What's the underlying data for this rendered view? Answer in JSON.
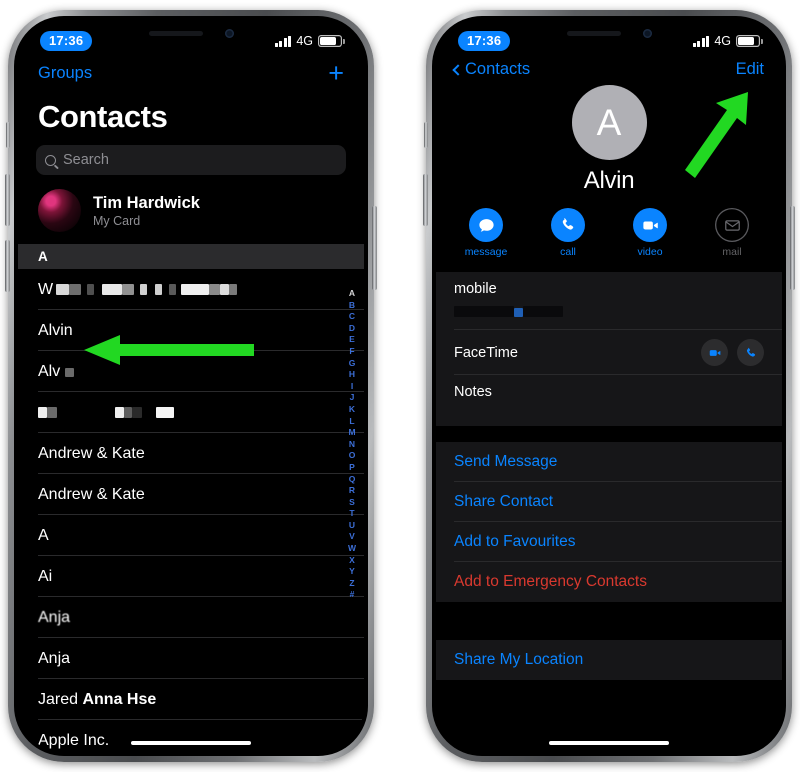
{
  "status_bar": {
    "time": "17:36",
    "network": "4G",
    "signal_icon": "cellular-bars-icon",
    "battery_icon": "battery-icon",
    "time_pill_color": "#0a84ff"
  },
  "colors": {
    "ios_blue": "#0a84ff",
    "ios_red": "#d9392f",
    "arrow_green": "#22d822",
    "screen_bg": "#000000",
    "card_bg": "#161618",
    "section_header_bg": "#2b2b2d"
  },
  "left_phone": {
    "nav": {
      "groups_label": "Groups",
      "add_label": "+"
    },
    "title": "Contacts",
    "search": {
      "placeholder": "Search",
      "value": "",
      "icon": "search-icon"
    },
    "my_card": {
      "name": "Tim Hardwick",
      "subtitle": "My Card",
      "avatar": "photo-avatar"
    },
    "section_header": "A",
    "rows": [
      {
        "prefix": "W",
        "redacted": true,
        "blocks": [
          14,
          9,
          6,
          5,
          5,
          22,
          9,
          5,
          4,
          5,
          4,
          4,
          26,
          12,
          9,
          5
        ],
        "label": ""
      },
      {
        "label": "Alvin",
        "redacted": false
      },
      {
        "prefix": "Alv",
        "redacted": true,
        "blocks": [
          7
        ],
        "label": ""
      },
      {
        "prefix": "",
        "redacted": true,
        "blocks": [
          9,
          9,
          0,
          0,
          0,
          8,
          9,
          10,
          0,
          16
        ],
        "label": ""
      },
      {
        "label": "Andrew & Kate",
        "redacted": false
      },
      {
        "label": "Andrew & Kate",
        "redacted": false
      },
      {
        "label": "A",
        "redacted": false
      },
      {
        "label": "Ai",
        "redacted": false
      },
      {
        "label": "Anja",
        "redacted": false,
        "smudged": true
      },
      {
        "label": "Anja",
        "redacted": false
      },
      {
        "label": "Jared Anna Hse",
        "redacted": false,
        "bold_part": "Anna Hse"
      },
      {
        "label": "Apple Inc.",
        "redacted": false
      }
    ],
    "index_letters": [
      "A",
      "B",
      "C",
      "D",
      "E",
      "F",
      "G",
      "H",
      "I",
      "J",
      "K",
      "L",
      "M",
      "N",
      "O",
      "P",
      "Q",
      "R",
      "S",
      "T",
      "U",
      "V",
      "W",
      "X",
      "Y",
      "Z",
      "#"
    ],
    "index_current": "A"
  },
  "right_phone": {
    "nav": {
      "back_label": "Contacts",
      "back_icon": "chevron-left-icon",
      "edit_label": "Edit"
    },
    "contact": {
      "monogram": "A",
      "name": "Alvin"
    },
    "actions": [
      {
        "label": "message",
        "icon": "message-bubble-icon",
        "enabled": true
      },
      {
        "label": "call",
        "icon": "phone-icon",
        "enabled": true
      },
      {
        "label": "video",
        "icon": "video-camera-icon",
        "enabled": true
      },
      {
        "label": "mail",
        "icon": "envelope-icon",
        "enabled": false
      }
    ],
    "detail_rows": [
      {
        "label": "mobile",
        "value": "",
        "redacted_value": true
      },
      {
        "label": "FaceTime",
        "buttons": [
          "video-camera-icon",
          "phone-icon"
        ]
      },
      {
        "label": "Notes",
        "value": ""
      }
    ],
    "links": [
      {
        "label": "Send Message",
        "style": "blue"
      },
      {
        "label": "Share Contact",
        "style": "blue"
      },
      {
        "label": "Add to Favourites",
        "style": "blue"
      },
      {
        "label": "Add to Emergency Contacts",
        "style": "red"
      }
    ],
    "footer_link": {
      "label": "Share My Location",
      "style": "blue"
    }
  },
  "annotations": [
    {
      "name": "arrow-to-alvin-row",
      "direction": "left",
      "color": "#22d822"
    },
    {
      "name": "arrow-to-edit-button",
      "direction": "up-right",
      "color": "#22d822"
    }
  ]
}
